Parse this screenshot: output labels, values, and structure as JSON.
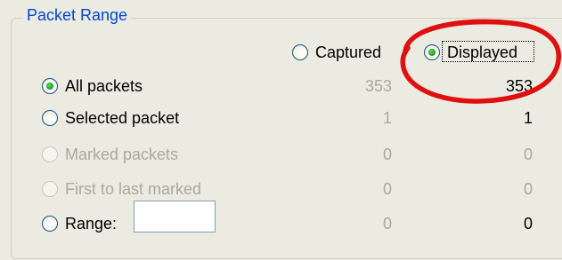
{
  "group": {
    "title": "Packet Range"
  },
  "columns": {
    "captured": "Captured",
    "displayed": "Displayed"
  },
  "rows": [
    {
      "label": "All packets",
      "captured": "353",
      "displayed": "353",
      "checked": true,
      "enabled": true
    },
    {
      "label": "Selected packet",
      "captured": "1",
      "displayed": "1",
      "checked": false,
      "enabled": true
    },
    {
      "label": "Marked packets",
      "captured": "0",
      "displayed": "0",
      "checked": false,
      "enabled": false
    },
    {
      "label": "First to last marked",
      "captured": "0",
      "displayed": "0",
      "checked": false,
      "enabled": false
    },
    {
      "label": "Range:",
      "captured": "0",
      "displayed": "0",
      "checked": false,
      "enabled": true
    }
  ],
  "range": {
    "value": ""
  },
  "selected_column": "displayed",
  "colors": {
    "legend": "#0046d5",
    "disabled_text": "#aca899",
    "annotation": "#e01010"
  }
}
